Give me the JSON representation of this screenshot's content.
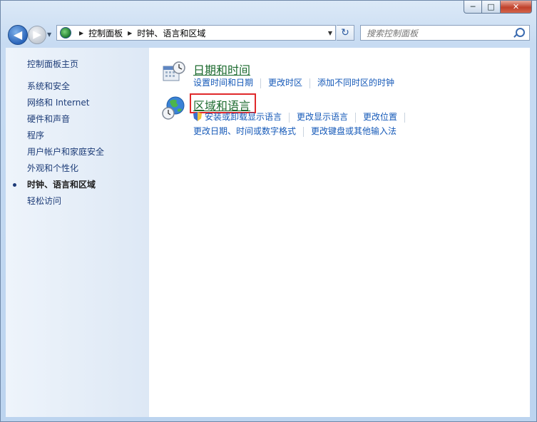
{
  "window": {
    "caption_buttons": {
      "minimize": "─",
      "maximize": "□",
      "close": "✕"
    }
  },
  "nav": {
    "back_glyph": "◀",
    "forward_glyph": "▶",
    "breadcrumb": [
      "控制面板",
      "时钟、语言和区域"
    ],
    "refresh_glyph": "↻",
    "search_placeholder": "搜索控制面板"
  },
  "sidebar": {
    "home": "控制面板主页",
    "items": [
      {
        "label": "系统和安全",
        "current": false
      },
      {
        "label": "网络和 Internet",
        "current": false
      },
      {
        "label": "硬件和声音",
        "current": false
      },
      {
        "label": "程序",
        "current": false
      },
      {
        "label": "用户帐户和家庭安全",
        "current": false
      },
      {
        "label": "外观和个性化",
        "current": false
      },
      {
        "label": "时钟、语言和区域",
        "current": true
      },
      {
        "label": "轻松访问",
        "current": false
      }
    ]
  },
  "categories": [
    {
      "title": "日期和时间",
      "icon": "calendar-clock-icon",
      "links": [
        "设置时间和日期",
        "更改时区",
        "添加不同时区的时钟"
      ]
    },
    {
      "title": "区域和语言",
      "icon": "globe-clock-icon",
      "highlighted": true,
      "links_row1": [
        "安装或卸载显示语言",
        "更改显示语言",
        "更改位置"
      ],
      "links_row2": [
        "更改日期、时间或数字格式",
        "更改键盘或其他输入法"
      ]
    }
  ],
  "colors": {
    "link": "#1559b8",
    "category_title": "#1b6a2e",
    "highlight_border": "#e0292b"
  }
}
